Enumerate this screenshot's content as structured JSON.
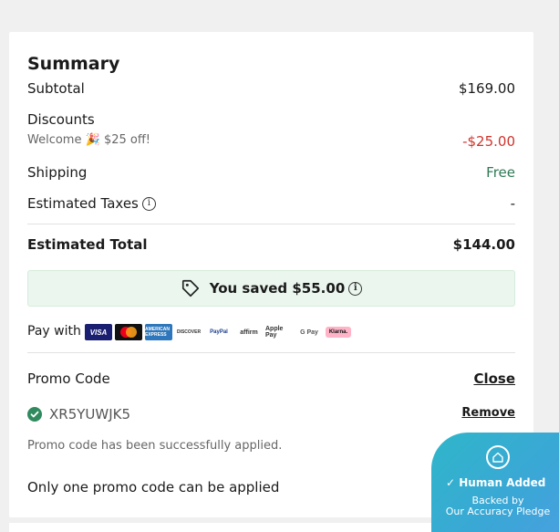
{
  "summary": {
    "title": "Summary",
    "subtotal_label": "Subtotal",
    "subtotal_value": "$169.00",
    "discounts_label": "Discounts",
    "discount_desc_prefix": "Welcome",
    "discount_desc_suffix": "$25 off!",
    "discount_value": "-$25.00",
    "shipping_label": "Shipping",
    "shipping_value": "Free",
    "taxes_label": "Estimated Taxes",
    "taxes_value": "-",
    "total_label": "Estimated Total",
    "total_value": "$144.00",
    "saved_text": "You saved $55.00"
  },
  "payment": {
    "label": "Pay with",
    "methods": [
      "VISA",
      "Mastercard",
      "AMERICAN EXPRESS",
      "DISCOVER",
      "PayPal",
      "affirm",
      "Apple Pay",
      "G Pay",
      "Klarna."
    ]
  },
  "promo": {
    "label": "Promo Code",
    "close_label": "Close",
    "code": "XR5YUWJK5",
    "remove_label": "Remove",
    "success_message": "Promo code has been successfully applied.",
    "limit_message": "Only one promo code can be applied"
  },
  "badge": {
    "title": "Human Added",
    "line1": "Backed by",
    "line2": "Our Accuracy Pledge"
  },
  "colors": {
    "discount": "#d0342c",
    "free": "#2f7a55",
    "saved_bg": "#eaf6ee",
    "check": "#2f8a5e"
  }
}
